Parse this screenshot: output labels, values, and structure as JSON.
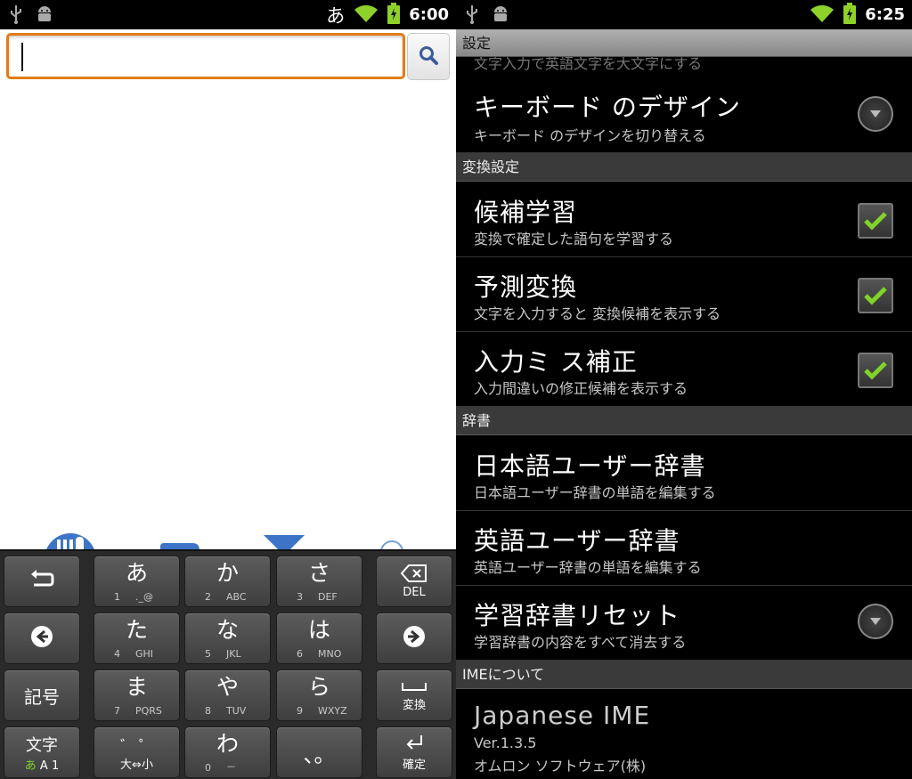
{
  "left": {
    "status": {
      "ime": "あ",
      "time": "6:00"
    },
    "search": {
      "value": ""
    },
    "keyboard": {
      "keys": [
        {
          "name": "undo-key",
          "icon": "undo-icon"
        },
        {
          "name": "key-a",
          "main": "あ",
          "num": "1",
          "sub": "._@"
        },
        {
          "name": "key-ka",
          "main": "か",
          "num": "2",
          "sub": "ABC"
        },
        {
          "name": "key-sa",
          "main": "さ",
          "num": "3",
          "sub": "DEF"
        },
        {
          "name": "del-key",
          "label": "DEL"
        },
        {
          "name": "left-arrow-key"
        },
        {
          "name": "key-ta",
          "main": "た",
          "num": "4",
          "sub": "GHI"
        },
        {
          "name": "key-na",
          "main": "な",
          "num": "5",
          "sub": "JKL"
        },
        {
          "name": "key-ha",
          "main": "は",
          "num": "6",
          "sub": "MNO"
        },
        {
          "name": "right-arrow-key"
        },
        {
          "name": "symbol-key",
          "label": "記号"
        },
        {
          "name": "key-ma",
          "main": "ま",
          "num": "7",
          "sub": "PQRS"
        },
        {
          "name": "key-ya",
          "main": "や",
          "num": "8",
          "sub": "TUV"
        },
        {
          "name": "key-ra",
          "main": "ら",
          "num": "9",
          "sub": "WXYZ"
        },
        {
          "name": "convert-key",
          "label": "変換"
        },
        {
          "name": "mode-key",
          "label": "文字",
          "label2a": "あ",
          "label2b": "A 1"
        },
        {
          "name": "dakuten-key",
          "main": "゛ ゜",
          "label": "大⇔小"
        },
        {
          "name": "key-wa",
          "main": "わ",
          "num": "0",
          "sub": "－"
        },
        {
          "name": "punct-key",
          "main": "、。"
        },
        {
          "name": "enter-key",
          "label": "確定"
        }
      ]
    }
  },
  "right": {
    "status": {
      "time": "6:25"
    },
    "header": "設定",
    "partial_summary": "文字入力で英語文字を大文字にする",
    "items": [
      {
        "title": "キーボード のデザイン",
        "summary": "キーボード のデザインを切り替える"
      },
      {
        "title": "候補学習",
        "summary": "変換で確定した語句を学習する"
      },
      {
        "title": "予測変換",
        "summary": "文字を入力すると 変換候補を表示する"
      },
      {
        "title": "入力ミ ス補正",
        "summary": "入力間違いの修正候補を表示する"
      },
      {
        "title": "日本語ユーザー辞書",
        "summary": "日本語ユーザー辞書の単語を編集する"
      },
      {
        "title": "英語ユーザー辞書",
        "summary": "英語ユーザー辞書の単語を編集する"
      },
      {
        "title": "学習辞書リセット",
        "summary": "学習辞書の内容をすべて消去する"
      },
      {
        "title": "Japanese IME",
        "summary": "Ver.1.3.5",
        "summary2": "オムロン ソフトウェア(株)"
      }
    ],
    "categories": [
      "変換設定",
      "辞書",
      "IMEについて"
    ],
    "checks": {
      "learning": true,
      "prediction": true,
      "correction": true
    }
  },
  "colors": {
    "accent_orange": "#e47b14",
    "check_green": "#7fd32a",
    "wifi_green": "#8ed12a"
  }
}
